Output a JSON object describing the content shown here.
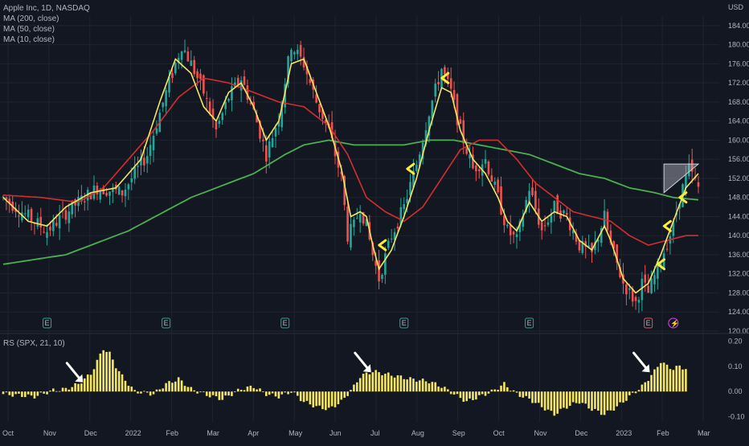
{
  "header": {
    "symbol": "Apple Inc, 1D, NASDAQ",
    "ma200": "MA (200, close)",
    "ma50": "MA (50, close)",
    "ma10": "MA (10, close)",
    "currency": "USD",
    "rs_label": "RS (SPX, 21, 10)"
  },
  "colors": {
    "background": "#131722",
    "grid": "#1f2430",
    "up": "#26a69a",
    "down": "#ef5350",
    "ma10": "#f5e663",
    "ma50": "#d32f2f",
    "ma200": "#4caf50",
    "rs_bar": "#f5e663",
    "arrow_yellow": "#ffeb3b",
    "arrow_white": "#ffffff"
  },
  "chart_data": [
    {
      "type": "candlestick",
      "y_axis_ticks": [
        "184.00",
        "180.00",
        "176.00",
        "172.00",
        "168.00",
        "164.00",
        "160.00",
        "156.00",
        "152.00",
        "148.00",
        "144.00",
        "140.00",
        "136.00",
        "132.00",
        "128.00",
        "124.00",
        "120.00"
      ],
      "ylim": [
        120,
        186
      ],
      "x_axis_ticks": [
        "Oct",
        "Nov",
        "Dec",
        "2022",
        "Feb",
        "Mar",
        "Apr",
        "May",
        "Jun",
        "Jul",
        "Aug",
        "Sep",
        "Oct",
        "Nov",
        "Dec",
        "2023",
        "Feb",
        "Mar"
      ],
      "price_path": [
        [
          0,
          148
        ],
        [
          8,
          144
        ],
        [
          14,
          141
        ],
        [
          22,
          146
        ],
        [
          30,
          150
        ],
        [
          38,
          149
        ],
        [
          46,
          157
        ],
        [
          52,
          170
        ],
        [
          57,
          180
        ],
        [
          60,
          176
        ],
        [
          64,
          170
        ],
        [
          68,
          162
        ],
        [
          72,
          169
        ],
        [
          76,
          173
        ],
        [
          80,
          166
        ],
        [
          84,
          157
        ],
        [
          88,
          165
        ],
        [
          92,
          180
        ],
        [
          96,
          176
        ],
        [
          100,
          168
        ],
        [
          104,
          162
        ],
        [
          108,
          152
        ],
        [
          110,
          140
        ],
        [
          112,
          142
        ],
        [
          114,
          146
        ],
        [
          116,
          142
        ],
        [
          118,
          136
        ],
        [
          120,
          131
        ],
        [
          124,
          140
        ],
        [
          128,
          146
        ],
        [
          132,
          155
        ],
        [
          136,
          166
        ],
        [
          140,
          175
        ],
        [
          143,
          170
        ],
        [
          146,
          162
        ],
        [
          150,
          154
        ],
        [
          154,
          156
        ],
        [
          158,
          148
        ],
        [
          161,
          141
        ],
        [
          164,
          139
        ],
        [
          168,
          150
        ],
        [
          172,
          141
        ],
        [
          176,
          146
        ],
        [
          180,
          144
        ],
        [
          184,
          138
        ],
        [
          188,
          136
        ],
        [
          192,
          144
        ],
        [
          194,
          138
        ],
        [
          198,
          130
        ],
        [
          202,
          126
        ],
        [
          204,
          130
        ],
        [
          206,
          128
        ],
        [
          210,
          135
        ],
        [
          214,
          142
        ],
        [
          216,
          148
        ],
        [
          219,
          154
        ],
        [
          222,
          150
        ]
      ],
      "ma10_path": [
        [
          0,
          148
        ],
        [
          8,
          143
        ],
        [
          14,
          142
        ],
        [
          20,
          146
        ],
        [
          28,
          149
        ],
        [
          36,
          150
        ],
        [
          44,
          156
        ],
        [
          50,
          168
        ],
        [
          55,
          177
        ],
        [
          60,
          174
        ],
        [
          64,
          167
        ],
        [
          68,
          164
        ],
        [
          72,
          170
        ],
        [
          76,
          172
        ],
        [
          80,
          167
        ],
        [
          84,
          160
        ],
        [
          88,
          164
        ],
        [
          92,
          176
        ],
        [
          96,
          177
        ],
        [
          100,
          170
        ],
        [
          104,
          163
        ],
        [
          108,
          154
        ],
        [
          111,
          144
        ],
        [
          114,
          145
        ],
        [
          116,
          144
        ],
        [
          118,
          138
        ],
        [
          120,
          133
        ],
        [
          124,
          137
        ],
        [
          128,
          144
        ],
        [
          132,
          152
        ],
        [
          136,
          162
        ],
        [
          140,
          171
        ],
        [
          143,
          170
        ],
        [
          146,
          162
        ],
        [
          150,
          156
        ],
        [
          154,
          153
        ],
        [
          158,
          148
        ],
        [
          161,
          143
        ],
        [
          164,
          141
        ],
        [
          168,
          147
        ],
        [
          172,
          143
        ],
        [
          176,
          145
        ],
        [
          180,
          144
        ],
        [
          184,
          139
        ],
        [
          188,
          137
        ],
        [
          192,
          142
        ],
        [
          194,
          139
        ],
        [
          198,
          131
        ],
        [
          202,
          128
        ],
        [
          206,
          130
        ],
        [
          210,
          136
        ],
        [
          214,
          143
        ],
        [
          218,
          150
        ],
        [
          222,
          153
        ]
      ],
      "ma50_path": [
        [
          0,
          148.5
        ],
        [
          12,
          148
        ],
        [
          24,
          147
        ],
        [
          32,
          150
        ],
        [
          40,
          156
        ],
        [
          48,
          162
        ],
        [
          56,
          169
        ],
        [
          64,
          173
        ],
        [
          72,
          172
        ],
        [
          80,
          170
        ],
        [
          88,
          168
        ],
        [
          96,
          167
        ],
        [
          104,
          163
        ],
        [
          110,
          157
        ],
        [
          116,
          148
        ],
        [
          122,
          145
        ],
        [
          128,
          143
        ],
        [
          134,
          146
        ],
        [
          140,
          152
        ],
        [
          146,
          158
        ],
        [
          152,
          160
        ],
        [
          158,
          160
        ],
        [
          164,
          156
        ],
        [
          170,
          151
        ],
        [
          176,
          148
        ],
        [
          182,
          145
        ],
        [
          188,
          144
        ],
        [
          194,
          143
        ],
        [
          200,
          140
        ],
        [
          206,
          138
        ],
        [
          212,
          139
        ],
        [
          218,
          140
        ],
        [
          222,
          140
        ]
      ],
      "ma200_path": [
        [
          0,
          134
        ],
        [
          20,
          136
        ],
        [
          40,
          141
        ],
        [
          60,
          148
        ],
        [
          80,
          153
        ],
        [
          90,
          157
        ],
        [
          96,
          159
        ],
        [
          104,
          160
        ],
        [
          112,
          159
        ],
        [
          120,
          159
        ],
        [
          128,
          159
        ],
        [
          136,
          160
        ],
        [
          144,
          160
        ],
        [
          152,
          159
        ],
        [
          160,
          158
        ],
        [
          168,
          157
        ],
        [
          176,
          155
        ],
        [
          184,
          153
        ],
        [
          192,
          152
        ],
        [
          200,
          150
        ],
        [
          208,
          149
        ],
        [
          214,
          148
        ],
        [
          222,
          147.5
        ]
      ],
      "triangle": [
        [
          211,
          155
        ],
        [
          216,
          155
        ],
        [
          222,
          155
        ],
        [
          211,
          149
        ]
      ],
      "yellow_arrows": [
        [
          138,
          173
        ],
        [
          127,
          154
        ],
        [
          118,
          138
        ],
        [
          214,
          148
        ],
        [
          209,
          142
        ],
        [
          207,
          134
        ]
      ],
      "earnings_markers": [
        "E",
        "E",
        "E",
        "E",
        "E",
        "E"
      ],
      "dividend_marker": "E",
      "split_marker": "⚡"
    },
    {
      "type": "bar",
      "name": "RS (SPX, 21, 10)",
      "y_axis_ticks": [
        "0.20",
        "0.10",
        "0.00",
        "-0.10"
      ],
      "ylim": [
        -0.12,
        0.22
      ],
      "rs_path": [
        [
          0,
          -0.01
        ],
        [
          10,
          -0.02
        ],
        [
          16,
          0.005
        ],
        [
          20,
          0.01
        ],
        [
          24,
          0.03
        ],
        [
          28,
          0.07
        ],
        [
          30,
          0.12
        ],
        [
          32,
          0.17
        ],
        [
          34,
          0.15
        ],
        [
          36,
          0.1
        ],
        [
          38,
          0.06
        ],
        [
          42,
          0.0
        ],
        [
          48,
          -0.01
        ],
        [
          52,
          0.03
        ],
        [
          56,
          0.05
        ],
        [
          60,
          0.01
        ],
        [
          64,
          -0.01
        ],
        [
          70,
          -0.03
        ],
        [
          76,
          0.01
        ],
        [
          80,
          0.02
        ],
        [
          84,
          -0.01
        ],
        [
          88,
          -0.02
        ],
        [
          92,
          0.0
        ],
        [
          96,
          -0.04
        ],
        [
          100,
          -0.06
        ],
        [
          104,
          -0.07
        ],
        [
          108,
          -0.04
        ],
        [
          112,
          0.02
        ],
        [
          114,
          0.06
        ],
        [
          118,
          0.08
        ],
        [
          122,
          0.07
        ],
        [
          126,
          0.06
        ],
        [
          130,
          0.05
        ],
        [
          136,
          0.04
        ],
        [
          140,
          0.02
        ],
        [
          144,
          -0.01
        ],
        [
          148,
          -0.04
        ],
        [
          152,
          -0.02
        ],
        [
          156,
          0.0
        ],
        [
          160,
          0.03
        ],
        [
          164,
          -0.01
        ],
        [
          168,
          -0.03
        ],
        [
          172,
          -0.06
        ],
        [
          176,
          -0.09
        ],
        [
          180,
          -0.06
        ],
        [
          184,
          -0.04
        ],
        [
          188,
          -0.07
        ],
        [
          192,
          -0.09
        ],
        [
          196,
          -0.06
        ],
        [
          200,
          -0.02
        ],
        [
          204,
          0.02
        ],
        [
          208,
          0.08
        ],
        [
          210,
          0.12
        ],
        [
          212,
          0.1
        ],
        [
          214,
          0.09
        ],
        [
          216,
          0.1
        ],
        [
          218,
          0.09
        ]
      ],
      "white_arrows": [
        [
          26,
          0.03
        ],
        [
          118,
          0.07
        ],
        [
          207,
          0.07
        ]
      ]
    }
  ]
}
